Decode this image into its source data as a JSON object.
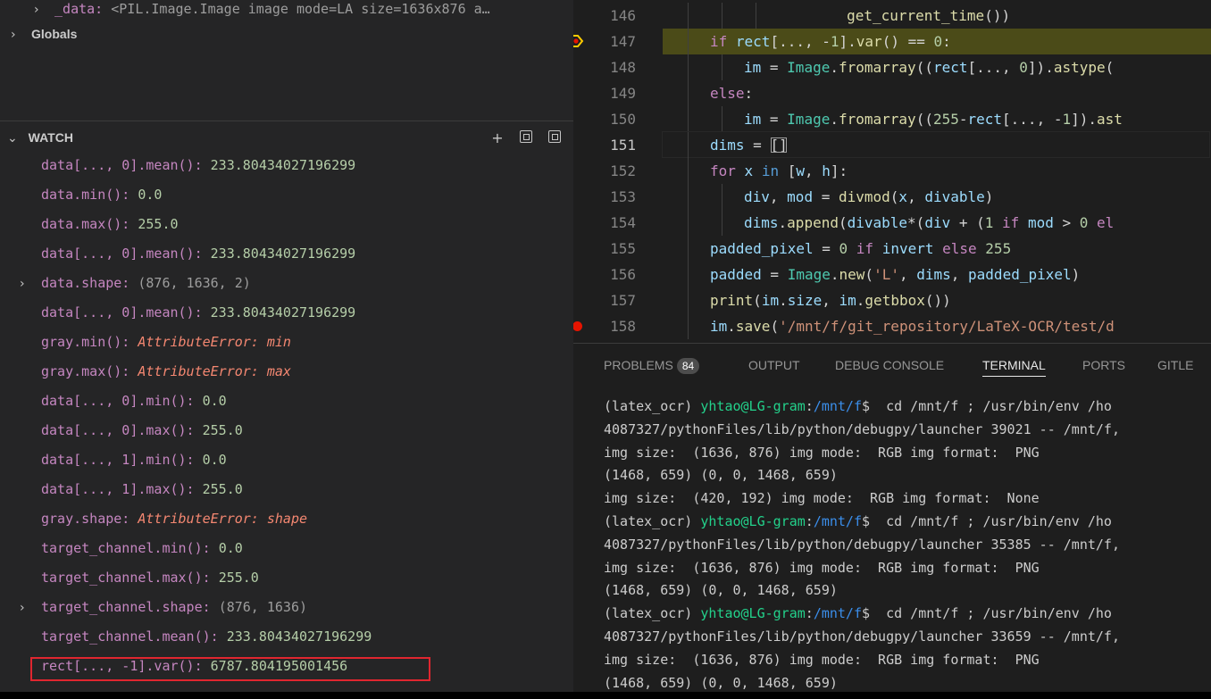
{
  "variables": {
    "data_row": {
      "name": "_data:",
      "value": "<PIL.Image.Image image mode=LA size=1636x876 a…"
    },
    "globals_label": "Globals"
  },
  "watch": {
    "title": "WATCH",
    "icons": [
      "add-icon",
      "collapse-all-icon",
      "remove-all-icon"
    ],
    "items": [
      {
        "name": "data[..., 0].mean():",
        "value": "233.80434027196299",
        "kind": "num",
        "expandable": false
      },
      {
        "name": "data.min():",
        "value": "0.0",
        "kind": "num",
        "expandable": false
      },
      {
        "name": "data.max():",
        "value": "255.0",
        "kind": "num",
        "expandable": false
      },
      {
        "name": "data[..., 0].mean():",
        "value": "233.80434027196299",
        "kind": "num",
        "expandable": false
      },
      {
        "name": "data.shape:",
        "value": "(876, 1636, 2)",
        "kind": "dim",
        "expandable": true
      },
      {
        "name": "data[..., 0].mean():",
        "value": "233.80434027196299",
        "kind": "num",
        "expandable": false
      },
      {
        "name": "gray.min():",
        "value": "AttributeError: min",
        "kind": "err",
        "expandable": false
      },
      {
        "name": "gray.max():",
        "value": "AttributeError: max",
        "kind": "err",
        "expandable": false
      },
      {
        "name": "data[..., 0].min():",
        "value": "0.0",
        "kind": "num",
        "expandable": false
      },
      {
        "name": "data[..., 0].max():",
        "value": "255.0",
        "kind": "num",
        "expandable": false
      },
      {
        "name": "data[..., 1].min():",
        "value": "0.0",
        "kind": "num",
        "expandable": false
      },
      {
        "name": "data[..., 1].max():",
        "value": "255.0",
        "kind": "num",
        "expandable": false
      },
      {
        "name": "gray.shape:",
        "value": "AttributeError: shape",
        "kind": "err",
        "expandable": false
      },
      {
        "name": "target_channel.min():",
        "value": "0.0",
        "kind": "num",
        "expandable": false
      },
      {
        "name": "target_channel.max():",
        "value": "255.0",
        "kind": "num",
        "expandable": false
      },
      {
        "name": "target_channel.shape:",
        "value": "(876, 1636)",
        "kind": "dim",
        "expandable": true
      },
      {
        "name": "target_channel.mean():",
        "value": "233.80434027196299",
        "kind": "num",
        "expandable": false
      },
      {
        "name": "rect[..., -1].var():",
        "value": "6787.804195001456",
        "kind": "num",
        "expandable": false
      }
    ]
  },
  "editor": {
    "lines": [
      {
        "n": "146",
        "indent": 3,
        "tokens": [
          [
            "plain",
            "        "
          ],
          [
            "fn",
            "get_current_time"
          ],
          [
            "plain",
            "())"
          ]
        ]
      },
      {
        "n": "147",
        "indent": 1,
        "current_exec": true,
        "tokens": [
          [
            "kw",
            "if"
          ],
          [
            "plain",
            " "
          ],
          [
            "var",
            "rect"
          ],
          [
            "plain",
            "[..., -"
          ],
          [
            "num",
            "1"
          ],
          [
            "plain",
            "]."
          ],
          [
            "fn",
            "var"
          ],
          [
            "plain",
            "() == "
          ],
          [
            "num",
            "0"
          ],
          [
            "plain",
            ":"
          ]
        ]
      },
      {
        "n": "148",
        "indent": 2,
        "tokens": [
          [
            "var",
            "im"
          ],
          [
            "plain",
            " = "
          ],
          [
            "cls",
            "Image"
          ],
          [
            "plain",
            "."
          ],
          [
            "fn",
            "fromarray"
          ],
          [
            "plain",
            "(("
          ],
          [
            "var",
            "rect"
          ],
          [
            "plain",
            "[..., "
          ],
          [
            "num",
            "0"
          ],
          [
            "plain",
            "])."
          ],
          [
            "fn",
            "astype"
          ],
          [
            "plain",
            "("
          ]
        ]
      },
      {
        "n": "149",
        "indent": 1,
        "tokens": [
          [
            "kw",
            "else"
          ],
          [
            "plain",
            ":"
          ]
        ]
      },
      {
        "n": "150",
        "indent": 2,
        "tokens": [
          [
            "var",
            "im"
          ],
          [
            "plain",
            " = "
          ],
          [
            "cls",
            "Image"
          ],
          [
            "plain",
            "."
          ],
          [
            "fn",
            "fromarray"
          ],
          [
            "plain",
            "(("
          ],
          [
            "num",
            "255"
          ],
          [
            "plain",
            "-"
          ],
          [
            "var",
            "rect"
          ],
          [
            "plain",
            "[..., -"
          ],
          [
            "num",
            "1"
          ],
          [
            "plain",
            "])."
          ],
          [
            "fn",
            "ast"
          ]
        ]
      },
      {
        "n": "151",
        "indent": 1,
        "cursor": true,
        "tokens": [
          [
            "var",
            "dims"
          ],
          [
            "plain",
            " = "
          ],
          [
            "plain",
            "[]"
          ]
        ]
      },
      {
        "n": "152",
        "indent": 1,
        "tokens": [
          [
            "kw",
            "for"
          ],
          [
            "plain",
            " "
          ],
          [
            "var",
            "x"
          ],
          [
            "plain",
            " "
          ],
          [
            "kw2",
            "in"
          ],
          [
            "plain",
            " ["
          ],
          [
            "var",
            "w"
          ],
          [
            "plain",
            ", "
          ],
          [
            "var",
            "h"
          ],
          [
            "plain",
            "]:"
          ]
        ]
      },
      {
        "n": "153",
        "indent": 2,
        "tokens": [
          [
            "var",
            "div"
          ],
          [
            "plain",
            ", "
          ],
          [
            "var",
            "mod"
          ],
          [
            "plain",
            " = "
          ],
          [
            "fn",
            "divmod"
          ],
          [
            "plain",
            "("
          ],
          [
            "var",
            "x"
          ],
          [
            "plain",
            ", "
          ],
          [
            "var",
            "divable"
          ],
          [
            "plain",
            ")"
          ]
        ]
      },
      {
        "n": "154",
        "indent": 2,
        "tokens": [
          [
            "var",
            "dims"
          ],
          [
            "plain",
            "."
          ],
          [
            "fn",
            "append"
          ],
          [
            "plain",
            "("
          ],
          [
            "var",
            "divable"
          ],
          [
            "plain",
            "*("
          ],
          [
            "var",
            "div"
          ],
          [
            "plain",
            " + ("
          ],
          [
            "num",
            "1"
          ],
          [
            "plain",
            " "
          ],
          [
            "kw",
            "if"
          ],
          [
            "plain",
            " "
          ],
          [
            "var",
            "mod"
          ],
          [
            "plain",
            " > "
          ],
          [
            "num",
            "0"
          ],
          [
            "plain",
            " "
          ],
          [
            "kw",
            "el"
          ]
        ]
      },
      {
        "n": "155",
        "indent": 1,
        "tokens": [
          [
            "var",
            "padded_pixel"
          ],
          [
            "plain",
            " = "
          ],
          [
            "num",
            "0"
          ],
          [
            "plain",
            " "
          ],
          [
            "kw",
            "if"
          ],
          [
            "plain",
            " "
          ],
          [
            "var",
            "invert"
          ],
          [
            "plain",
            " "
          ],
          [
            "kw",
            "else"
          ],
          [
            "plain",
            " "
          ],
          [
            "num",
            "255"
          ]
        ]
      },
      {
        "n": "156",
        "indent": 1,
        "tokens": [
          [
            "var",
            "padded"
          ],
          [
            "plain",
            " = "
          ],
          [
            "cls",
            "Image"
          ],
          [
            "plain",
            "."
          ],
          [
            "fn",
            "new"
          ],
          [
            "plain",
            "("
          ],
          [
            "str",
            "'L'"
          ],
          [
            "plain",
            ", "
          ],
          [
            "var",
            "dims"
          ],
          [
            "plain",
            ", "
          ],
          [
            "var",
            "padded_pixel"
          ],
          [
            "plain",
            ")"
          ]
        ]
      },
      {
        "n": "157",
        "indent": 1,
        "tokens": [
          [
            "fn",
            "print"
          ],
          [
            "plain",
            "("
          ],
          [
            "var",
            "im"
          ],
          [
            "plain",
            "."
          ],
          [
            "var",
            "size"
          ],
          [
            "plain",
            ", "
          ],
          [
            "var",
            "im"
          ],
          [
            "plain",
            "."
          ],
          [
            "fn",
            "getbbox"
          ],
          [
            "plain",
            "())"
          ]
        ]
      },
      {
        "n": "158",
        "indent": 1,
        "breakpoint": true,
        "tokens": [
          [
            "var",
            "im"
          ],
          [
            "plain",
            "."
          ],
          [
            "fn",
            "save"
          ],
          [
            "plain",
            "("
          ],
          [
            "str",
            "'/mnt/f/git_repository/LaTeX-OCR/test/d"
          ]
        ]
      }
    ]
  },
  "panel": {
    "tabs": [
      {
        "label": "PROBLEMS",
        "badge": "84"
      },
      {
        "label": "OUTPUT"
      },
      {
        "label": "DEBUG CONSOLE"
      },
      {
        "label": "TERMINAL",
        "active": true
      },
      {
        "label": "PORTS"
      },
      {
        "label": "GITLE"
      }
    ],
    "terminal": [
      {
        "prompt": true,
        "env": "(latex_ocr) ",
        "user": "yhtao@LG-gram",
        "path": "/mnt/f",
        "cmd": "$  cd /mnt/f ; /usr/bin/env /ho"
      },
      {
        "text": "4087327/pythonFiles/lib/python/debugpy/launcher 39021 -- /mnt/f,"
      },
      {
        "text": "img size:  (1636, 876) img mode:  RGB img format:  PNG"
      },
      {
        "text": "(1468, 659) (0, 0, 1468, 659)"
      },
      {
        "text": "img size:  (420, 192) img mode:  RGB img format:  None"
      },
      {
        "prompt": true,
        "env": "(latex_ocr) ",
        "user": "yhtao@LG-gram",
        "path": "/mnt/f",
        "cmd": "$  cd /mnt/f ; /usr/bin/env /ho"
      },
      {
        "text": "4087327/pythonFiles/lib/python/debugpy/launcher 35385 -- /mnt/f,"
      },
      {
        "text": "img size:  (1636, 876) img mode:  RGB img format:  PNG"
      },
      {
        "text": "(1468, 659) (0, 0, 1468, 659)"
      },
      {
        "prompt": true,
        "env": "(latex_ocr) ",
        "user": "yhtao@LG-gram",
        "path": "/mnt/f",
        "cmd": "$  cd /mnt/f ; /usr/bin/env /ho"
      },
      {
        "text": "4087327/pythonFiles/lib/python/debugpy/launcher 33659 -- /mnt/f,"
      },
      {
        "text": "img size:  (1636, 876) img mode:  RGB img format:  PNG"
      },
      {
        "text": "(1468, 659) (0, 0, 1468, 659)"
      }
    ]
  }
}
